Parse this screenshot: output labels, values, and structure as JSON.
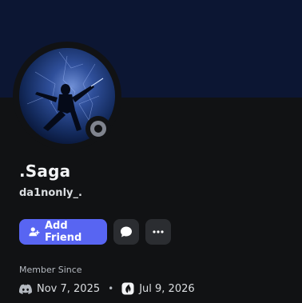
{
  "profile": {
    "display_name": ".Saga",
    "username": "da1nonly_.",
    "status": "offline"
  },
  "actions": {
    "add_friend_label": "Add Friend",
    "message_icon": "chat-bubble-icon",
    "more_icon": "ellipsis-icon"
  },
  "member_since": {
    "label": "Member Since",
    "discord_date": "Nov 7, 2025",
    "server_date": "Jul 9, 2026",
    "separator": "•"
  },
  "colors": {
    "banner": "#0c1633",
    "background": "#111214",
    "accent": "#5865f2",
    "status_offline": "#80848e"
  }
}
